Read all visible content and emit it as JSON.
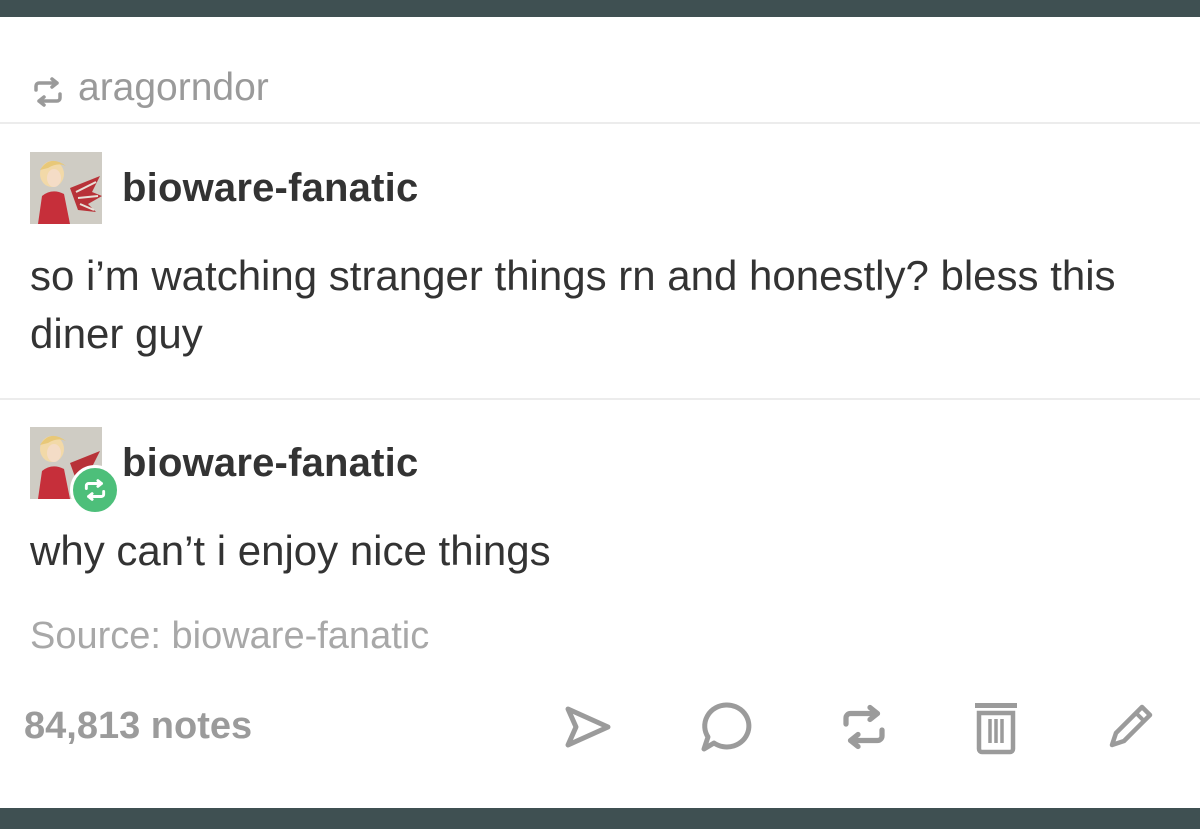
{
  "reblog_header": {
    "username": "aragorndor",
    "icon": "reblog-icon"
  },
  "posts": [
    {
      "username": "bioware-fanatic",
      "text": "so i’m watching stranger things rn and honestly? bless this diner guy",
      "avatar_icon": "avatar"
    },
    {
      "username": "bioware-fanatic",
      "text": "why can’t i enjoy nice things",
      "avatar_icon": "avatar",
      "badge_icon": "reblog-badge-icon"
    }
  ],
  "source": "Source: bioware-fanatic",
  "footer": {
    "notes": "84,813 notes",
    "actions": [
      "share-icon",
      "reply-icon",
      "reblog-icon",
      "delete-icon",
      "edit-icon"
    ]
  },
  "colors": {
    "bezel": "#3f5052",
    "badge": "#4dbf7a",
    "text": "#333333",
    "muted": "#9b9b9b"
  }
}
